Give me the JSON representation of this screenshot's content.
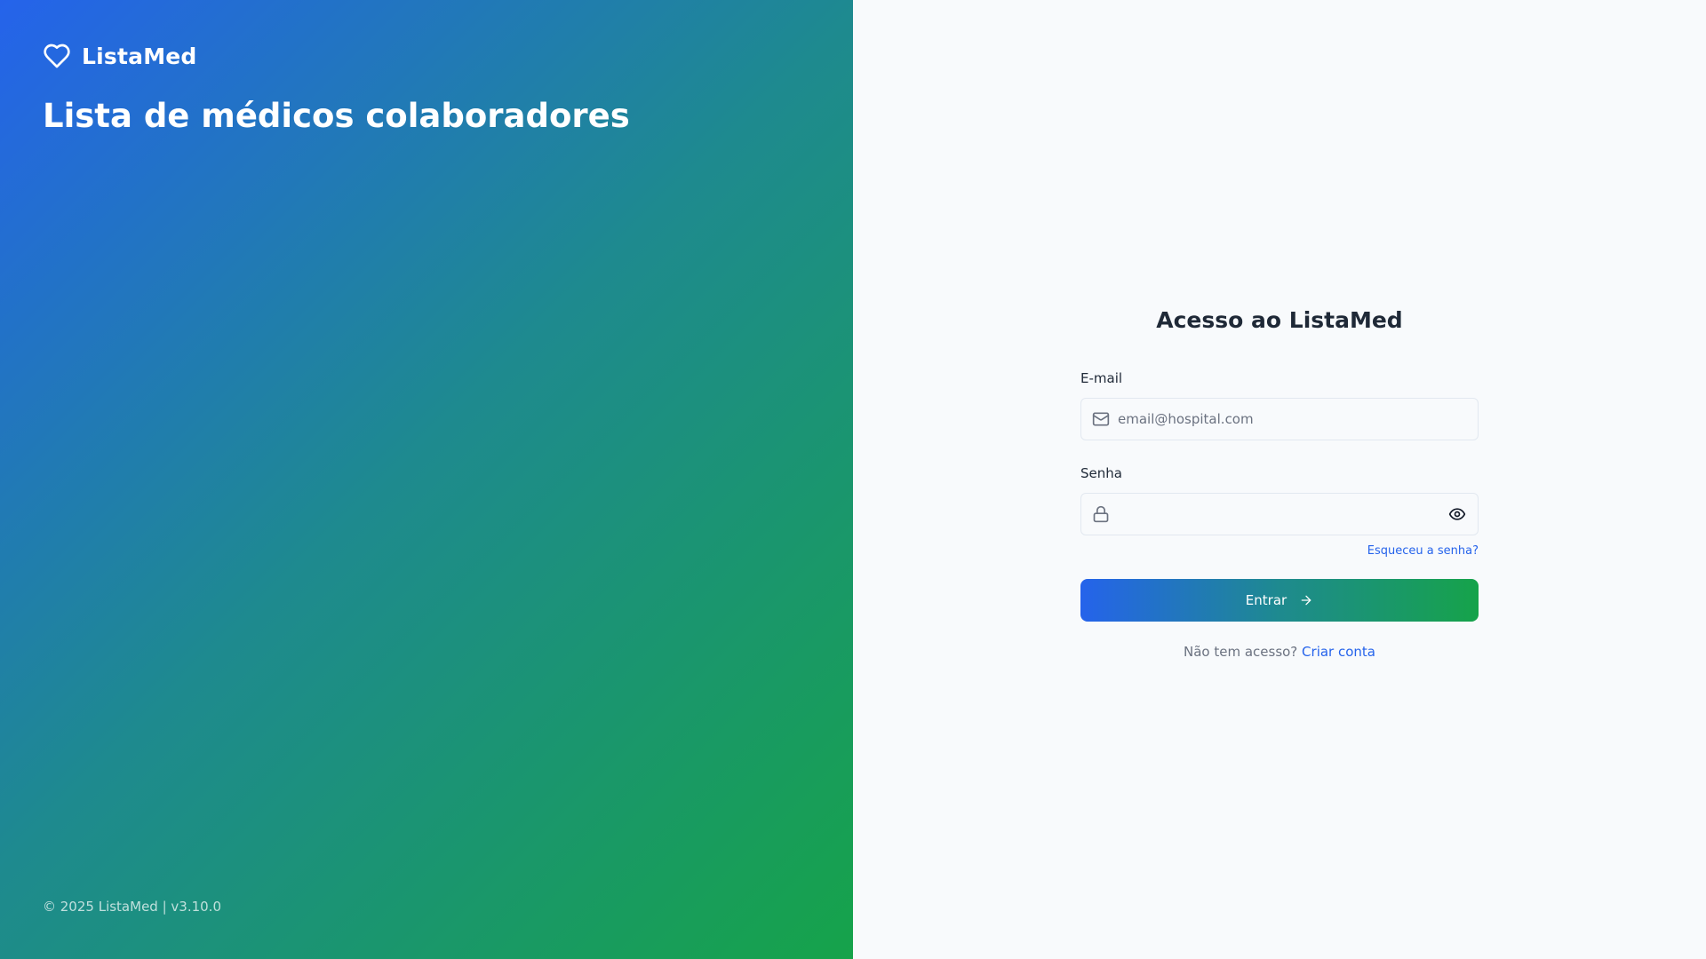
{
  "brand": {
    "name": "ListaMed",
    "icon": "heart-icon"
  },
  "hero": {
    "title": "Lista de médicos colaboradores",
    "footer": "© 2025 ListaMed | v3.10.0"
  },
  "login": {
    "title": "Acesso ao ListaMed",
    "email": {
      "label": "E-mail",
      "placeholder": "email@hospital.com",
      "value": "",
      "icon": "mail-icon"
    },
    "password": {
      "label": "Senha",
      "value": "",
      "icon": "lock-icon",
      "toggle_icon": "eye-icon"
    },
    "forgot_link": "Esqueceu a senha?",
    "submit_label": "Entrar",
    "submit_icon": "arrow-right-icon",
    "signup_prompt": "Não tem acesso?",
    "signup_link": "Criar conta"
  },
  "colors": {
    "gradient_start": "#2563eb",
    "gradient_end": "#16a34a",
    "link": "#2563eb",
    "title_text": "#1f2937",
    "muted_text": "#6b7280",
    "panel_bg": "#f8fafc"
  }
}
